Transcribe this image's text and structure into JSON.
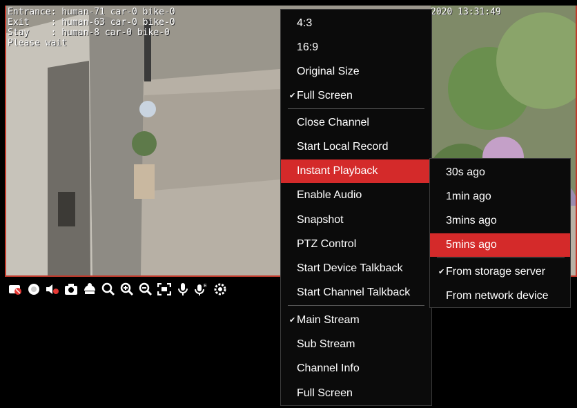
{
  "osd": {
    "line1": "Entrance: human-71 car-0 bike-0",
    "line2": "Exit    : human-63 car-0 bike-0",
    "line3": "Stay    : human-8 car-0 bike-0",
    "line4": "Please wait",
    "timestamp": "2020 13:31:49"
  },
  "toolbar_icons": [
    "close-eye-icon",
    "record-icon",
    "mute-icon",
    "snapshot-icon",
    "ptz-icon",
    "zoom-search-icon",
    "zoom-in-icon",
    "zoom-out-icon",
    "fit-screen-icon",
    "mic-icon",
    "mic-e-icon",
    "settings-icon"
  ],
  "context_menu": {
    "items": [
      {
        "label": "4:3"
      },
      {
        "label": "16:9"
      },
      {
        "label": "Original Size"
      },
      {
        "label": "Full Screen",
        "checked": "✔"
      },
      {
        "label": "Close Channel"
      },
      {
        "label": "Start Local Record"
      },
      {
        "label": "Instant Playback",
        "active": true
      },
      {
        "label": "Enable Audio"
      },
      {
        "label": "Snapshot"
      },
      {
        "label": "PTZ Control"
      },
      {
        "label": "Start Device Talkback"
      },
      {
        "label": "Start Channel Talkback"
      },
      {
        "label": "Main Stream",
        "checked": "✔"
      },
      {
        "label": "Sub Stream"
      },
      {
        "label": "Channel Info"
      },
      {
        "label": "Full Screen"
      }
    ]
  },
  "submenu": {
    "items": [
      {
        "label": "30s ago"
      },
      {
        "label": "1min ago"
      },
      {
        "label": "3mins ago"
      },
      {
        "label": "5mins ago",
        "active": true
      },
      {
        "label": "From storage server",
        "checked": "✔"
      },
      {
        "label": "From network device"
      }
    ]
  },
  "colors": {
    "accent": "#d42a2a",
    "menu_bg": "#0b0b0b"
  }
}
